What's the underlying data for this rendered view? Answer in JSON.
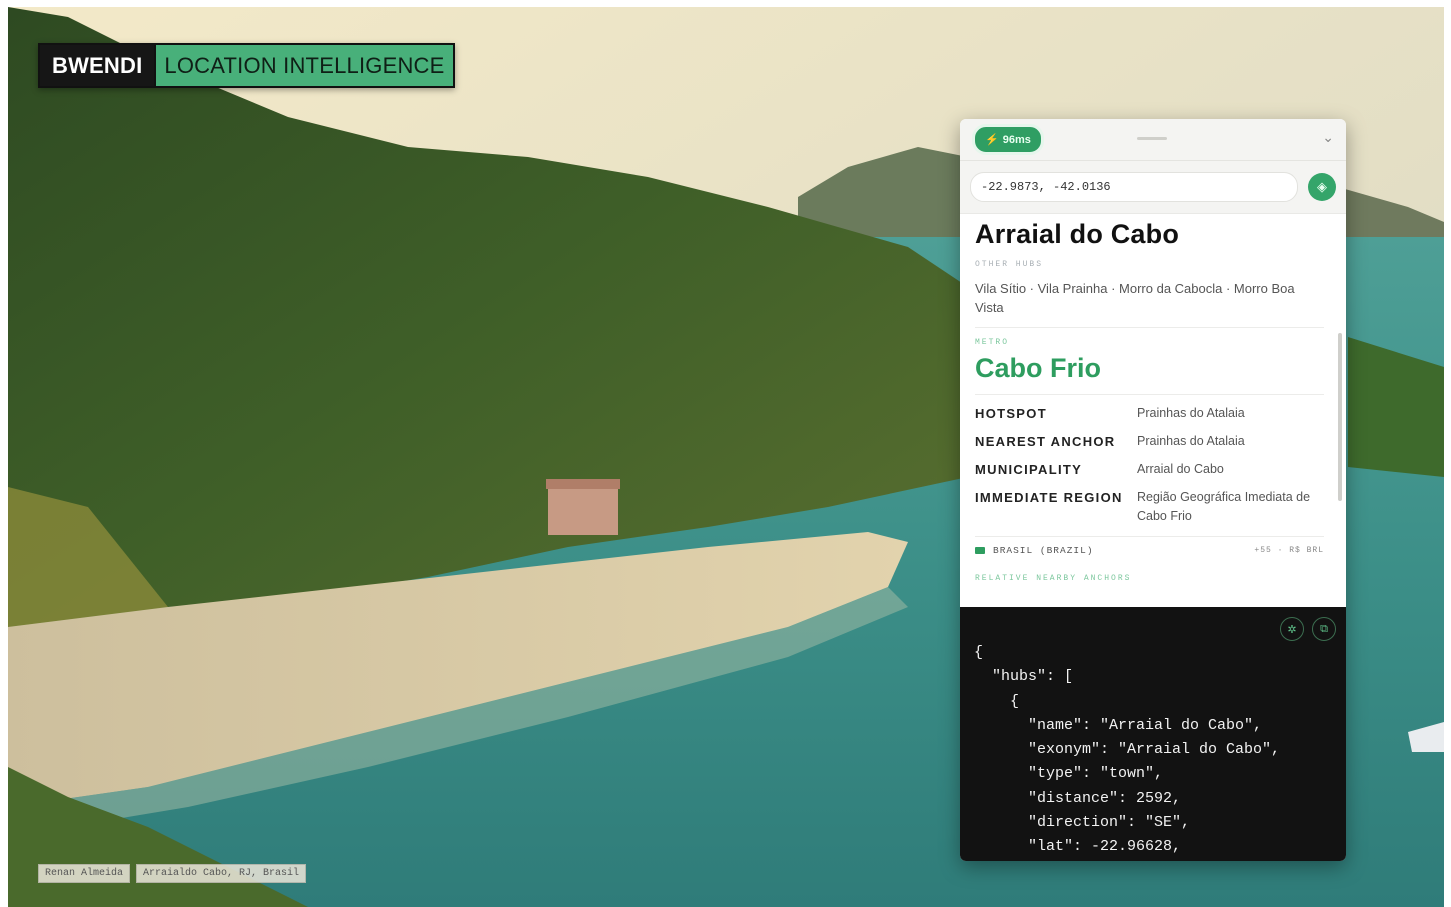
{
  "brand": {
    "name": "BWENDI",
    "tagline": "LOCATION INTELLIGENCE"
  },
  "credits": [
    "Renan Almeida",
    "Arraialdo Cabo, RJ, Brasil"
  ],
  "panel": {
    "latency": "96ms",
    "latency_icon": "bolt-icon",
    "collapse_icon": "chevron-down-icon",
    "coordinates": "-22.9873, -42.0136",
    "locate_icon": "crosshair-icon",
    "place_title": "Arraial do Cabo",
    "other_hubs_label": "OTHER HUBS",
    "other_hubs": "Vila Sítio · Vila Prainha · Morro da Cabocla · Morro Boa Vista",
    "metro_label": "METRO",
    "metro": "Cabo Frio",
    "details": [
      {
        "key": "HOTSPOT",
        "value": "Prainhas do Atalaia"
      },
      {
        "key": "NEAREST ANCHOR",
        "value": "Prainhas do Atalaia"
      },
      {
        "key": "MUNICIPALITY",
        "value": "Arraial do Cabo"
      },
      {
        "key": "IMMEDIATE REGION",
        "value": "Região Geográfica Imediata de Cabo Frio"
      }
    ],
    "country": "BRASIL (BRAZIL)",
    "country_extra": "+55 · R$ BRL",
    "relative_label": "RELATIVE NEARBY ANCHORS",
    "code_tools": [
      "expand-icon",
      "copy-icon"
    ],
    "json_lines": [
      "{",
      "  \"hubs\": [",
      "    {",
      "      \"name\": \"Arraial do Cabo\",",
      "      \"exonym\": \"Arraial do Cabo\",",
      "      \"type\": \"town\",",
      "      \"distance\": 2592,",
      "      \"direction\": \"SE\",",
      "      \"lat\": -22.96628,"
    ]
  },
  "colors": {
    "accent": "#2e9d5f",
    "brand_dark": "#161616",
    "brand_green": "#48b07a",
    "code_bg": "#121212"
  }
}
